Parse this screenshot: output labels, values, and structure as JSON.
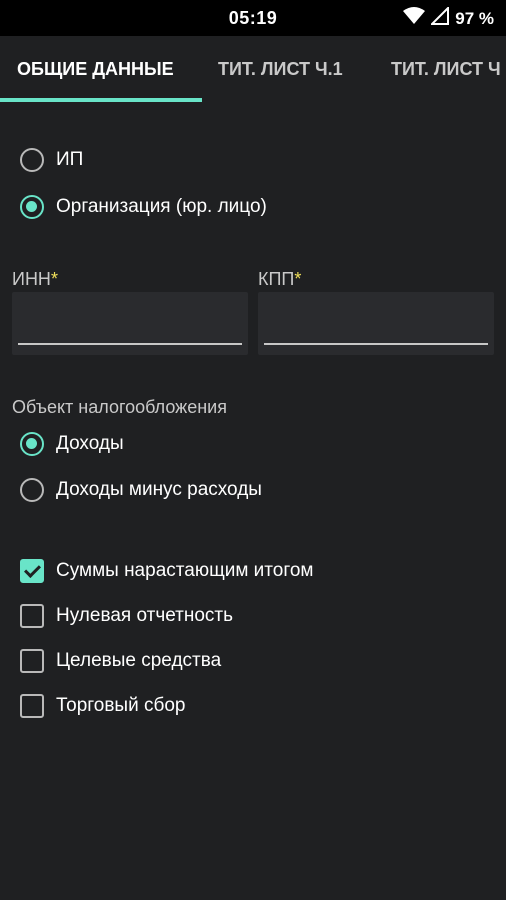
{
  "status_bar": {
    "time": "05:19",
    "battery": "97 %"
  },
  "tabs": [
    {
      "label": "ОБЩИЕ ДАННЫЕ"
    },
    {
      "label": "ТИТ. ЛИСТ Ч.1"
    },
    {
      "label": "ТИТ. ЛИСТ Ч"
    }
  ],
  "taxpayer_type": {
    "options": [
      {
        "label": "ИП",
        "selected": false
      },
      {
        "label": "Организация (юр. лицо)",
        "selected": true
      }
    ]
  },
  "fields": {
    "inn": {
      "label": "ИНН",
      "required_mark": "*",
      "value": ""
    },
    "kpp": {
      "label": "КПП",
      "required_mark": "*",
      "value": ""
    }
  },
  "tax_object": {
    "label": "Объект налогообложения",
    "options": [
      {
        "label": "Доходы",
        "selected": true
      },
      {
        "label": "Доходы минус расходы",
        "selected": false
      }
    ]
  },
  "flags": [
    {
      "label": "Суммы нарастающим итогом",
      "checked": true
    },
    {
      "label": "Нулевая отчетность",
      "checked": false
    },
    {
      "label": "Целевые средства",
      "checked": false
    },
    {
      "label": "Торговый сбор",
      "checked": false
    }
  ],
  "colors": {
    "accent": "#69e4c8",
    "required": "#f1e05a",
    "background": "#1f2022"
  }
}
